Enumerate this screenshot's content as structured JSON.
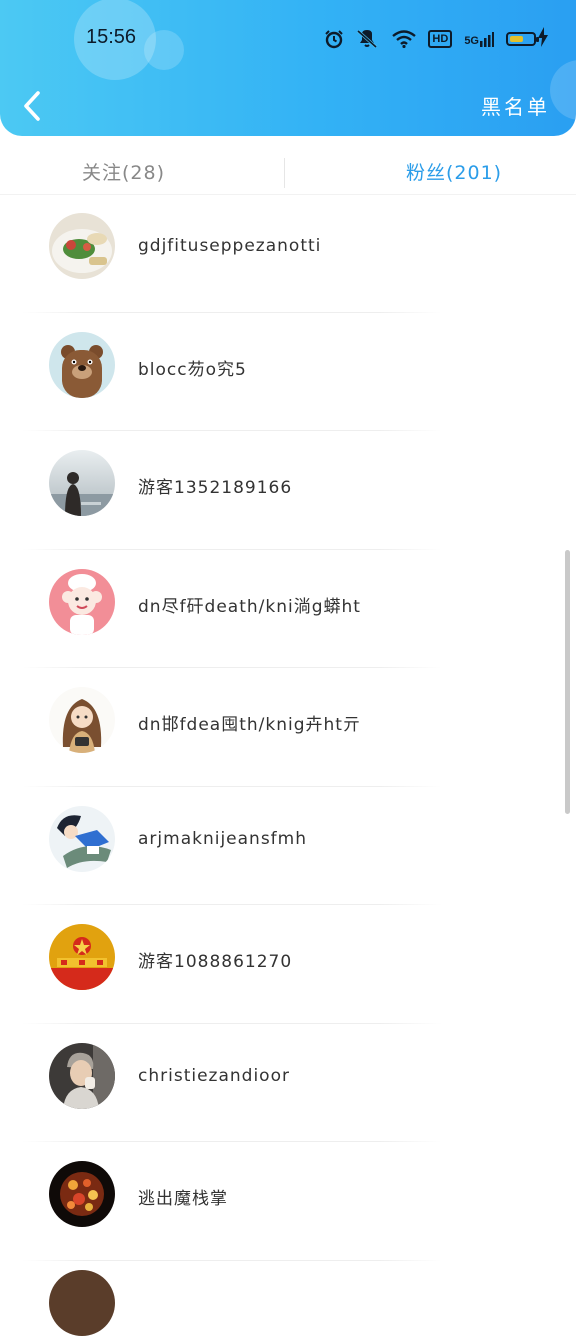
{
  "status_bar": {
    "time": "15:56",
    "icons": [
      "alarm-icon",
      "mute-icon",
      "wifi-icon",
      "hd-icon",
      "signal-5g-icon",
      "battery-icon",
      "charging-icon"
    ],
    "hd_label": "HD",
    "signal_label": "5G",
    "battery_level": 0.65
  },
  "header": {
    "back_icon": "chevron-left-icon",
    "blacklist_label": "黑名单",
    "colors": {
      "gradient_start": "#4cc9f3",
      "gradient_end": "#2a9ff2"
    }
  },
  "tabs": {
    "follow_label": "关注(28)",
    "fans_label": "粉丝(201)",
    "active": "fans",
    "active_color": "#2b9de9",
    "inactive_color": "#888888"
  },
  "fans": [
    {
      "name": "gdjfituseppezanotti",
      "avatar": "food-plate-avatar"
    },
    {
      "name": "blocc芴o究5",
      "avatar": "bear-cartoon-avatar"
    },
    {
      "name": "游客1352189166",
      "avatar": "girl-silhouette-avatar"
    },
    {
      "name": "dn尽f矸death/kni淌g蟒ht",
      "avatar": "chef-cartoon-avatar"
    },
    {
      "name": "dn邯fdea囤th/knig卉ht亓",
      "avatar": "anime-girl-avatar"
    },
    {
      "name": "arjmaknijeansfmh",
      "avatar": "anime-boy-avatar"
    },
    {
      "name": "游客1088861270",
      "avatar": "emblem-avatar"
    },
    {
      "name": "christiezandioor",
      "avatar": "man-photo-avatar"
    },
    {
      "name": "逃出魔栈掌",
      "avatar": "mosaic-lamp-avatar"
    }
  ]
}
